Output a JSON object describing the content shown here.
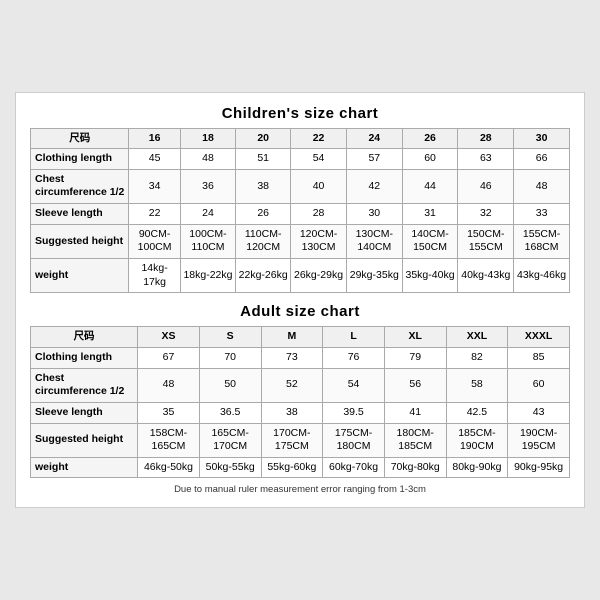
{
  "children_chart": {
    "title": "Children's size chart",
    "columns": [
      "尺码",
      "16",
      "18",
      "20",
      "22",
      "24",
      "26",
      "28",
      "30"
    ],
    "rows": [
      {
        "label": "Clothing length",
        "values": [
          "45",
          "48",
          "51",
          "54",
          "57",
          "60",
          "63",
          "66"
        ]
      },
      {
        "label": "Chest circumference 1/2",
        "values": [
          "34",
          "36",
          "38",
          "40",
          "42",
          "44",
          "46",
          "48"
        ]
      },
      {
        "label": "Sleeve length",
        "values": [
          "22",
          "24",
          "26",
          "28",
          "30",
          "31",
          "32",
          "33"
        ]
      },
      {
        "label": "Suggested height",
        "values": [
          "90CM-100CM",
          "100CM-110CM",
          "110CM-120CM",
          "120CM-130CM",
          "130CM-140CM",
          "140CM-150CM",
          "150CM-155CM",
          "155CM-168CM"
        ]
      },
      {
        "label": "weight",
        "values": [
          "14kg-17kg",
          "18kg-22kg",
          "22kg-26kg",
          "26kg-29kg",
          "29kg-35kg",
          "35kg-40kg",
          "40kg-43kg",
          "43kg-46kg"
        ]
      }
    ]
  },
  "adult_chart": {
    "title": "Adult size chart",
    "columns": [
      "尺码",
      "XS",
      "S",
      "M",
      "L",
      "XL",
      "XXL",
      "XXXL"
    ],
    "rows": [
      {
        "label": "Clothing length",
        "values": [
          "67",
          "70",
          "73",
          "76",
          "79",
          "82",
          "85"
        ]
      },
      {
        "label": "Chest circumference 1/2",
        "values": [
          "48",
          "50",
          "52",
          "54",
          "56",
          "58",
          "60"
        ]
      },
      {
        "label": "Sleeve length",
        "values": [
          "35",
          "36.5",
          "38",
          "39.5",
          "41",
          "42.5",
          "43"
        ]
      },
      {
        "label": "Suggested height",
        "values": [
          "158CM-165CM",
          "165CM-170CM",
          "170CM-175CM",
          "175CM-180CM",
          "180CM-185CM",
          "185CM-190CM",
          "190CM-195CM"
        ]
      },
      {
        "label": "weight",
        "values": [
          "46kg-50kg",
          "50kg-55kg",
          "55kg-60kg",
          "60kg-70kg",
          "70kg-80kg",
          "80kg-90kg",
          "90kg-95kg"
        ]
      }
    ]
  },
  "note": "Due to manual ruler measurement error ranging from 1-3cm"
}
